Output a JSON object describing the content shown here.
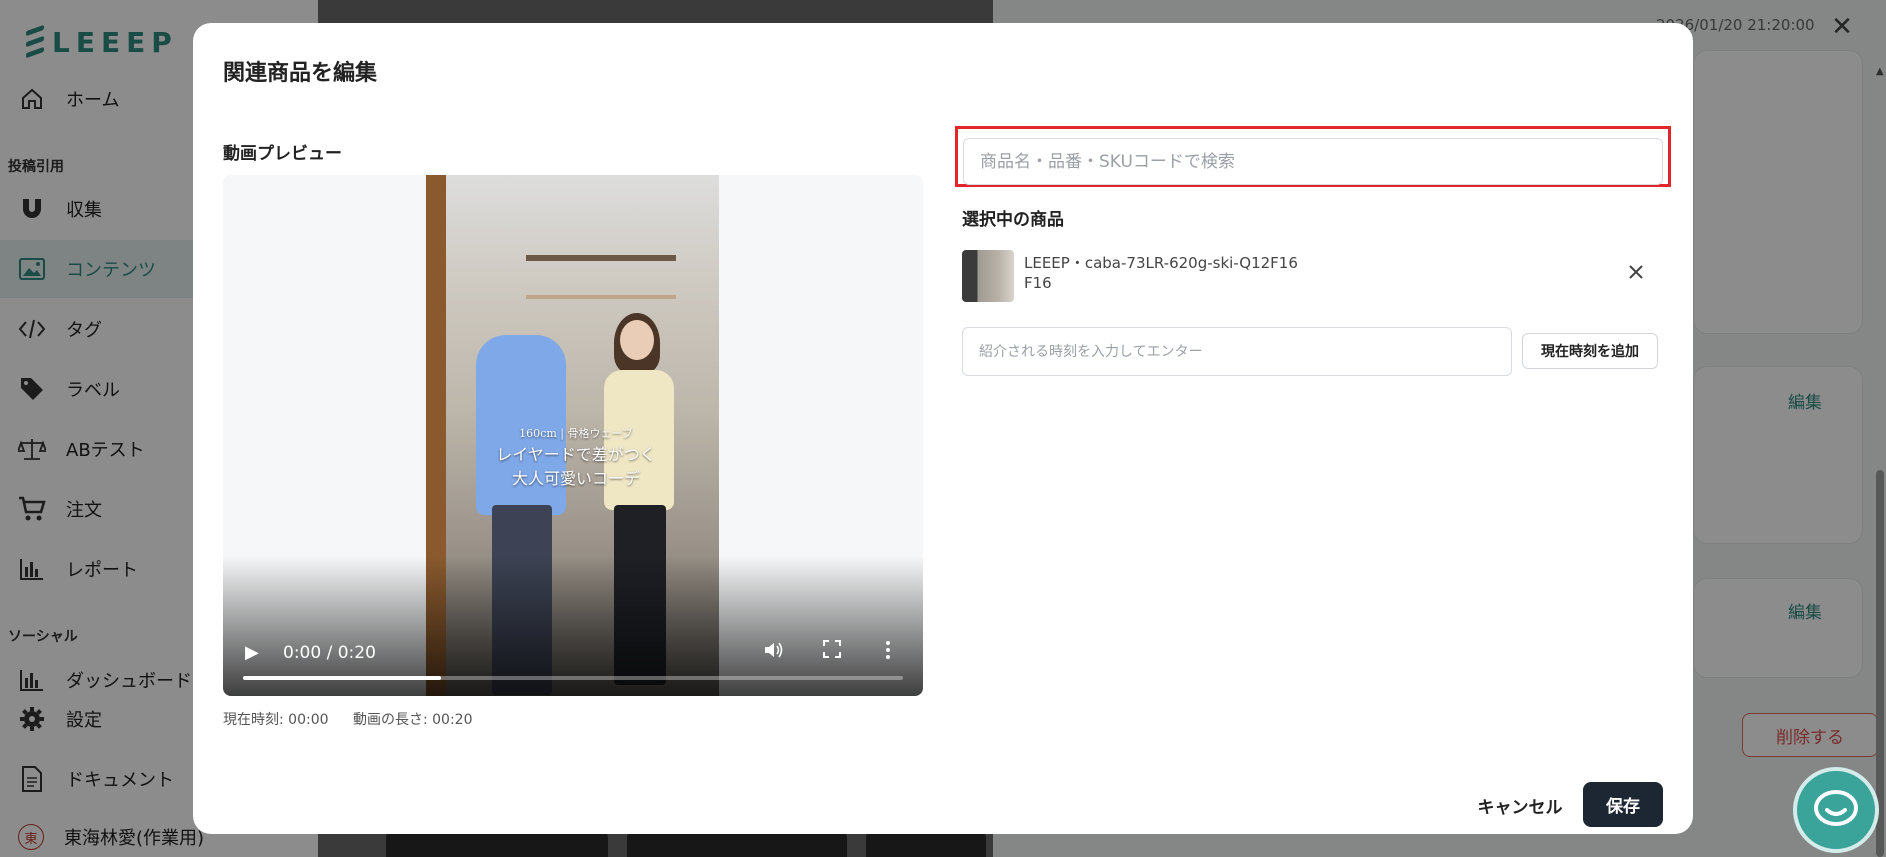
{
  "app": {
    "logo": "LEEEP",
    "brand_color": "#2f8a7e"
  },
  "sidebar": {
    "items": [
      {
        "label": "ホーム",
        "icon": "home-icon"
      },
      {
        "section": "投稿引用"
      },
      {
        "label": "収集",
        "icon": "magnet-icon"
      },
      {
        "label": "コンテンツ",
        "icon": "image-icon",
        "active": true
      },
      {
        "label": "タグ",
        "icon": "code-icon"
      },
      {
        "label": "ラベル",
        "icon": "tag-icon"
      },
      {
        "label": "ABテスト",
        "icon": "scale-icon"
      },
      {
        "label": "注文",
        "icon": "cart-icon"
      },
      {
        "label": "レポート",
        "icon": "bar-chart-icon"
      },
      {
        "section": "ソーシャル"
      },
      {
        "label": "ダッシュボード",
        "icon": "bar-chart-icon"
      },
      {
        "label": "設定",
        "icon": "gear-icon"
      },
      {
        "label": "ドキュメント",
        "icon": "document-icon"
      },
      {
        "label": "東海林愛(作業用)",
        "icon": "avatar-icon",
        "avatar_text": "東"
      }
    ]
  },
  "background_panel": {
    "timestamp": "2026/01/20 21:20:00",
    "edit_label": "編集",
    "delete_label": "削除する"
  },
  "modal": {
    "title": "関連商品を編集",
    "preview_label": "動画プレビュー",
    "video": {
      "caption_line1": "160cm | 骨格ウェーブ",
      "caption_line2": "レイヤードで差がつく",
      "caption_line3": "大人可愛いコーデ",
      "time_display": "0:00 / 0:20",
      "progress": 0.3
    },
    "current_time": "現在時刻: 00:00",
    "duration": "動画の長さ: 00:20",
    "search": {
      "placeholder": "商品名・品番・SKUコードで検索",
      "value": ""
    },
    "selected_label": "選択中の商品",
    "selected_products": [
      {
        "name": "LEEEP・caba-73LR-620g-ski-Q12F16",
        "sub": "F16"
      }
    ],
    "time_input_placeholder": "紹介される時刻を入力してエンター",
    "add_time_button": "現在時刻を追加",
    "cancel_button": "キャンセル",
    "save_button": "保存"
  }
}
